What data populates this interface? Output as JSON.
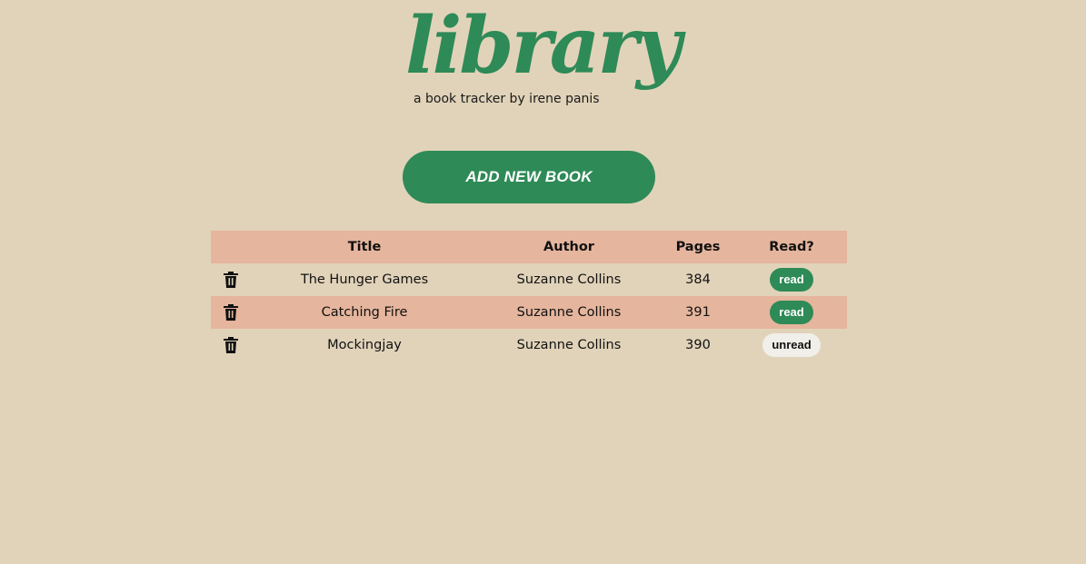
{
  "header": {
    "title": "library",
    "subtitle": "a book tracker by irene panis"
  },
  "add_button": {
    "label": "ADD NEW BOOK"
  },
  "table": {
    "columns": [
      "",
      "Title",
      "Author",
      "Pages",
      "Read?"
    ],
    "rows": [
      {
        "title": "The Hunger Games",
        "author": "Suzanne Collins",
        "pages": "384",
        "status": "read"
      },
      {
        "title": "Catching Fire",
        "author": "Suzanne Collins",
        "pages": "391",
        "status": "read"
      },
      {
        "title": "Mockingjay",
        "author": "Suzanne Collins",
        "pages": "390",
        "status": "unread"
      }
    ]
  },
  "colors": {
    "background": "#e1d3b9",
    "accent": "#2e8a57",
    "row_shade": "#e5b59d",
    "unread_pill": "#f1efea"
  },
  "icons": {
    "delete": "trash-icon"
  }
}
